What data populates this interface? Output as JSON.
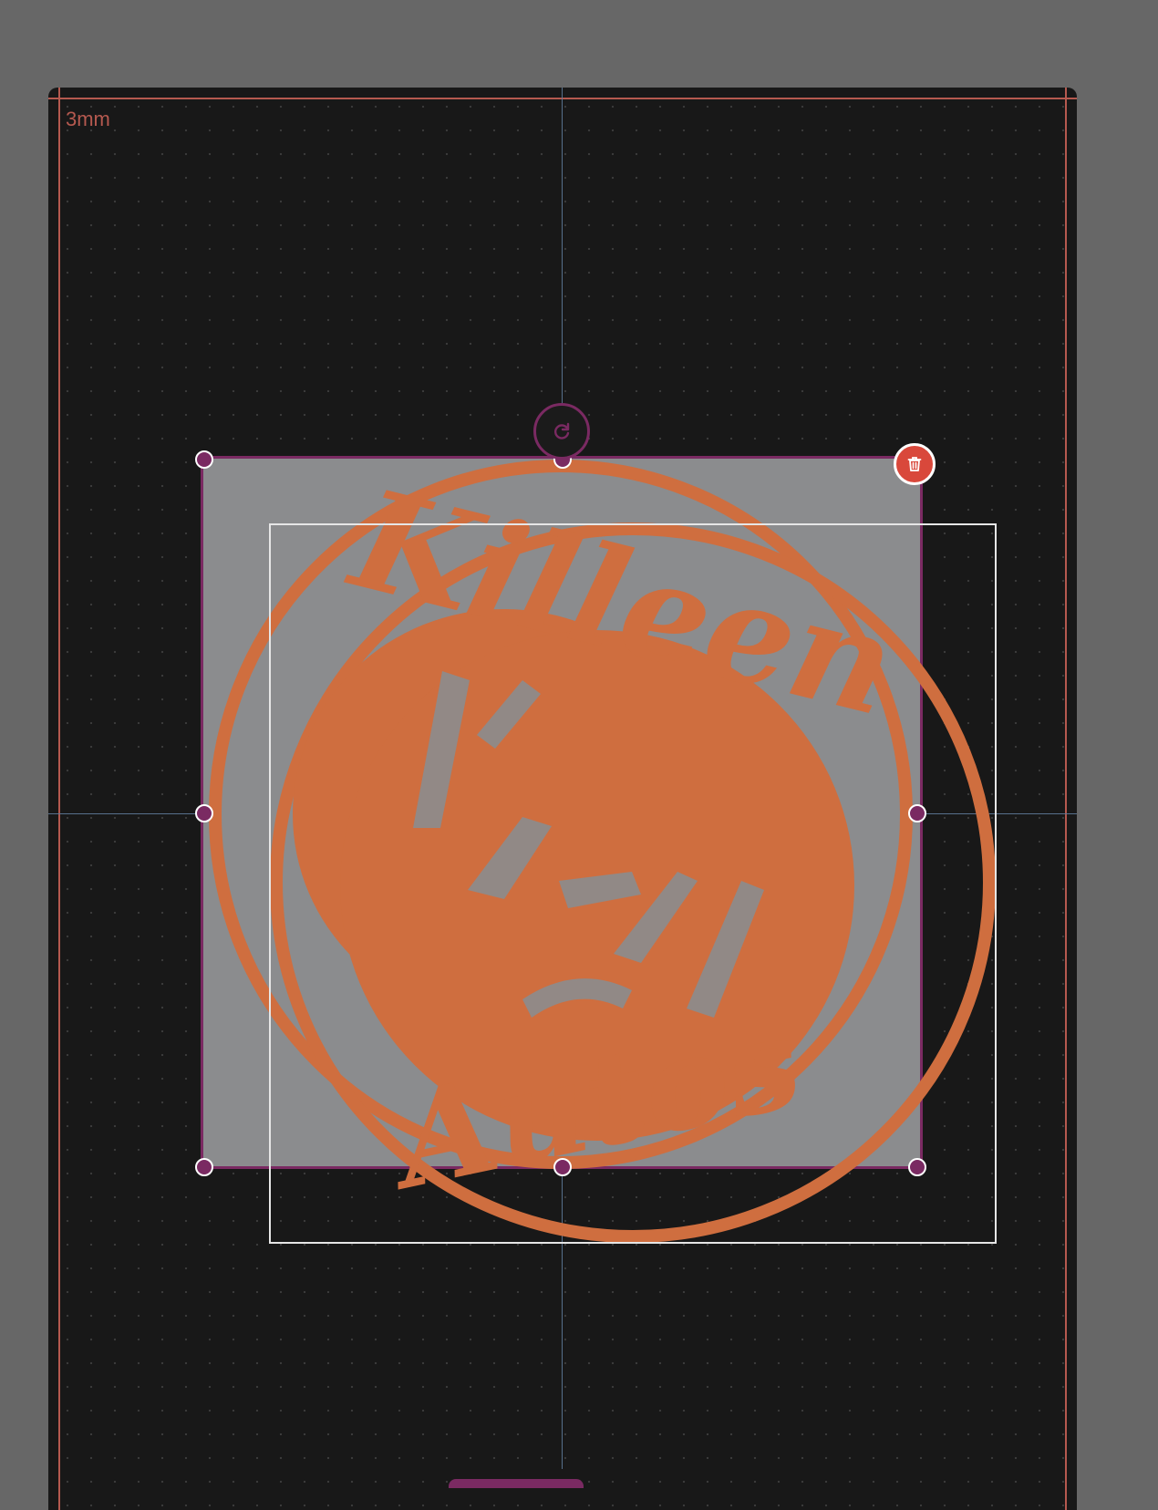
{
  "canvas": {
    "bleed_label": "3mm",
    "colors": {
      "workspace": "#676767",
      "artboard": "#181818",
      "bleed": "#b5594f",
      "guide": "#5e7a99",
      "selection_border": "#7a2a62",
      "selection_fill": "#8b8c8e",
      "logo": "#cf6e3f",
      "delete": "#d9483b"
    }
  },
  "selection": {
    "handles": [
      "top-left",
      "top-center",
      "top-right",
      "middle-left",
      "middle-right",
      "bottom-left",
      "bottom-center",
      "bottom-right"
    ],
    "rotate_icon": "rotate-icon",
    "delete_icon": "trash-icon"
  },
  "logo": {
    "top_text": "Killeen",
    "bottom_text": "Autos"
  }
}
